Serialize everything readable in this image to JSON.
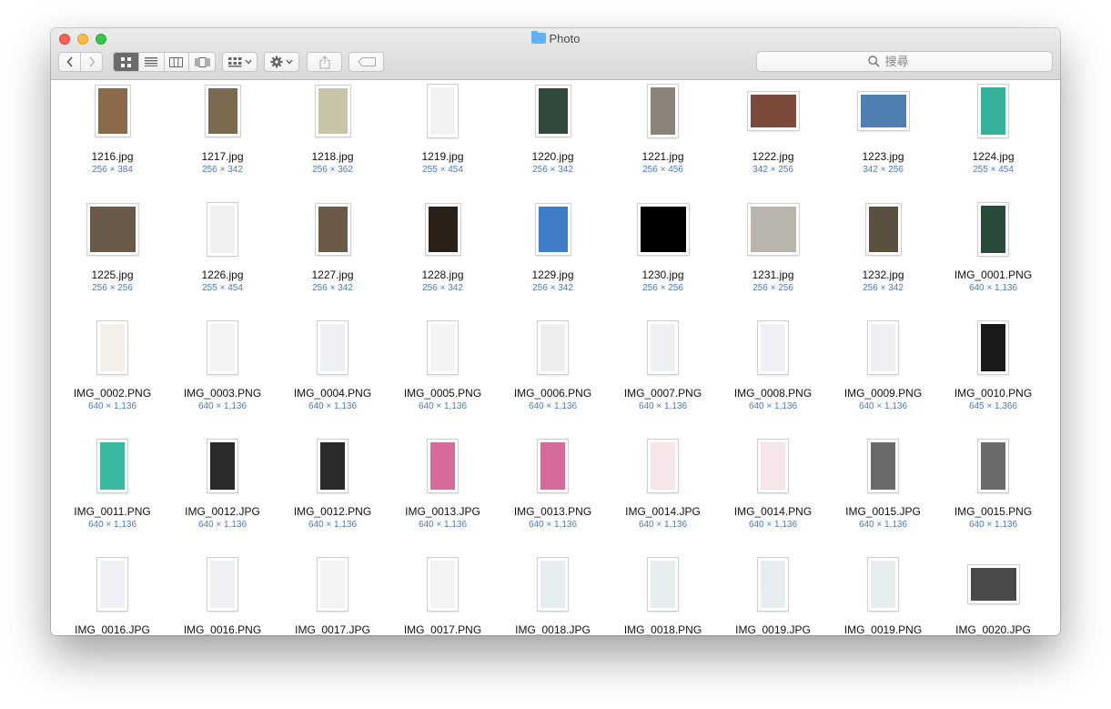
{
  "window": {
    "title": "Photo",
    "search_placeholder": "搜尋"
  },
  "files": [
    {
      "name": "1216.jpg",
      "dims": "256 × 384",
      "orient": "p",
      "color": "#8a6a4a"
    },
    {
      "name": "1217.jpg",
      "dims": "256 × 342",
      "orient": "p",
      "color": "#7a6a50"
    },
    {
      "name": "1218.jpg",
      "dims": "256 × 362",
      "orient": "p",
      "color": "#c9c4a8"
    },
    {
      "name": "1219.jpg",
      "dims": "255 × 454",
      "orient": "s",
      "color": "#f2f2f2"
    },
    {
      "name": "1220.jpg",
      "dims": "256 × 342",
      "orient": "p",
      "color": "#2f4a3a"
    },
    {
      "name": "1221.jpg",
      "dims": "256 × 456",
      "orient": "s",
      "color": "#8a8378"
    },
    {
      "name": "1222.jpg",
      "dims": "342 × 256",
      "orient": "l",
      "color": "#7a4a3a"
    },
    {
      "name": "1223.jpg",
      "dims": "342 × 256",
      "orient": "l",
      "color": "#4e7fb0"
    },
    {
      "name": "1224.jpg",
      "dims": "255 × 454",
      "orient": "s",
      "color": "#37b29a"
    },
    {
      "name": "1225.jpg",
      "dims": "256 × 256",
      "orient": "q",
      "color": "#6a5a4a"
    },
    {
      "name": "1226.jpg",
      "dims": "255 × 454",
      "orient": "s",
      "color": "#f0f0f3"
    },
    {
      "name": "1227.jpg",
      "dims": "256 × 342",
      "orient": "p",
      "color": "#6b5a48"
    },
    {
      "name": "1228.jpg",
      "dims": "256 × 342",
      "orient": "p",
      "color": "#2a2018"
    },
    {
      "name": "1229.jpg",
      "dims": "256 × 342",
      "orient": "p",
      "color": "#3f7dc8"
    },
    {
      "name": "1230.jpg",
      "dims": "256 × 256",
      "orient": "q",
      "color": "#000000"
    },
    {
      "name": "1231.jpg",
      "dims": "256 × 256",
      "orient": "q",
      "color": "#b9b5ad"
    },
    {
      "name": "1232.jpg",
      "dims": "256 × 342",
      "orient": "p",
      "color": "#5a5040"
    },
    {
      "name": "IMG_0001.PNG",
      "dims": "640 × 1,136",
      "orient": "s",
      "color": "#2a4a3a"
    },
    {
      "name": "IMG_0002.PNG",
      "dims": "640 × 1,136",
      "orient": "s",
      "color": "#f3efe9"
    },
    {
      "name": "IMG_0003.PNG",
      "dims": "640 × 1,136",
      "orient": "s",
      "color": "#f3f3f3"
    },
    {
      "name": "IMG_0004.PNG",
      "dims": "640 × 1,136",
      "orient": "s",
      "color": "#eef0f4"
    },
    {
      "name": "IMG_0005.PNG",
      "dims": "640 × 1,136",
      "orient": "s",
      "color": "#f4f4f4"
    },
    {
      "name": "IMG_0006.PNG",
      "dims": "640 × 1,136",
      "orient": "s",
      "color": "#eeeeee"
    },
    {
      "name": "IMG_0007.PNG",
      "dims": "640 × 1,136",
      "orient": "s",
      "color": "#eef0f4"
    },
    {
      "name": "IMG_0008.PNG",
      "dims": "640 × 1,136",
      "orient": "s",
      "color": "#eef0f4"
    },
    {
      "name": "IMG_0009.PNG",
      "dims": "640 × 1,136",
      "orient": "s",
      "color": "#eef0f4"
    },
    {
      "name": "IMG_0010.PNG",
      "dims": "645 × 1,366",
      "orient": "s",
      "color": "#1a1a1a"
    },
    {
      "name": "IMG_0011.PNG",
      "dims": "640 × 1,136",
      "orient": "s",
      "color": "#3ab8a0"
    },
    {
      "name": "IMG_0012.JPG",
      "dims": "640 × 1,136",
      "orient": "s",
      "color": "#2a2a2a"
    },
    {
      "name": "IMG_0012.PNG",
      "dims": "640 × 1,136",
      "orient": "s",
      "color": "#2a2a2a"
    },
    {
      "name": "IMG_0013.JPG",
      "dims": "640 × 1,136",
      "orient": "s",
      "color": "#d66a9a"
    },
    {
      "name": "IMG_0013.PNG",
      "dims": "640 × 1,136",
      "orient": "s",
      "color": "#d66a9a"
    },
    {
      "name": "IMG_0014.JPG",
      "dims": "640 × 1,136",
      "orient": "s",
      "color": "#f6e6ea"
    },
    {
      "name": "IMG_0014.PNG",
      "dims": "640 × 1,136",
      "orient": "s",
      "color": "#f6e6ea"
    },
    {
      "name": "IMG_0015.JPG",
      "dims": "640 × 1,136",
      "orient": "s",
      "color": "#6a6a6a"
    },
    {
      "name": "IMG_0015.PNG",
      "dims": "640 × 1,136",
      "orient": "s",
      "color": "#6a6a6a"
    },
    {
      "name": "IMG_0016.JPG",
      "dims": "",
      "orient": "s",
      "color": "#eef0f4"
    },
    {
      "name": "IMG_0016.PNG",
      "dims": "",
      "orient": "s",
      "color": "#eef0f4"
    },
    {
      "name": "IMG_0017.JPG",
      "dims": "",
      "orient": "s",
      "color": "#f3f3f3"
    },
    {
      "name": "IMG_0017.PNG",
      "dims": "",
      "orient": "s",
      "color": "#f3f3f3"
    },
    {
      "name": "IMG_0018.JPG",
      "dims": "",
      "orient": "s",
      "color": "#e6eef0"
    },
    {
      "name": "IMG_0018.PNG",
      "dims": "",
      "orient": "s",
      "color": "#e6eef0"
    },
    {
      "name": "IMG_0019.JPG",
      "dims": "",
      "orient": "s",
      "color": "#e6eef0"
    },
    {
      "name": "IMG_0019.PNG",
      "dims": "",
      "orient": "s",
      "color": "#e6eef0"
    },
    {
      "name": "IMG_0020.JPG",
      "dims": "",
      "orient": "l",
      "color": "#4a4a4a"
    }
  ]
}
